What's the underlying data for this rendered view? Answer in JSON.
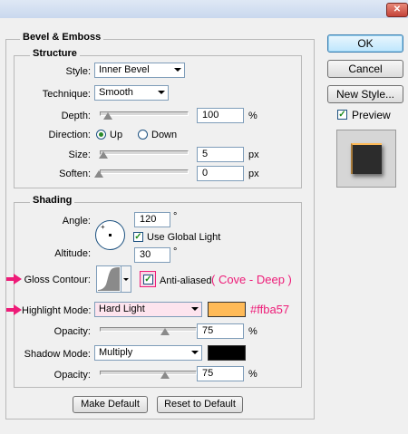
{
  "window": {
    "close_glyph": "✕"
  },
  "bevel_emboss": {
    "title": "Bevel & Emboss"
  },
  "structure": {
    "title": "Structure",
    "style": {
      "label": "Style:",
      "value": "Inner Bevel"
    },
    "technique": {
      "label": "Technique:",
      "value": "Smooth"
    },
    "depth": {
      "label": "Depth:",
      "value": "100",
      "unit": "%",
      "slider_pct": 0.1
    },
    "direction": {
      "label": "Direction:",
      "up": "Up",
      "down": "Down",
      "selected": "Up"
    },
    "size": {
      "label": "Size:",
      "value": "5",
      "unit": "px",
      "slider_pct": 0.04
    },
    "soften": {
      "label": "Soften:",
      "value": "0",
      "unit": "px",
      "slider_pct": 0
    }
  },
  "shading": {
    "title": "Shading",
    "angle": {
      "label": "Angle:",
      "value": "120",
      "unit": "°"
    },
    "use_global_light": {
      "label": "Use Global Light",
      "checked": true
    },
    "altitude": {
      "label": "Altitude:",
      "value": "30",
      "unit": "°"
    },
    "gloss_contour": {
      "label": "Gloss Contour:",
      "anti_aliased_label": "Anti-aliased",
      "anti_aliased_checked": true
    },
    "highlight_mode": {
      "label": "Highlight Mode:",
      "value": "Hard Light",
      "color": "#ffba57"
    },
    "highlight_opacity": {
      "label": "Opacity:",
      "value": "75",
      "unit": "%",
      "slider_pct": 0.75
    },
    "shadow_mode": {
      "label": "Shadow Mode:",
      "value": "Multiply",
      "color": "#000000"
    },
    "shadow_opacity": {
      "label": "Opacity:",
      "value": "75",
      "unit": "%",
      "slider_pct": 0.75
    }
  },
  "buttons": {
    "make_default": "Make Default",
    "reset_default": "Reset to Default",
    "ok": "OK",
    "cancel": "Cancel",
    "new_style": "New Style...",
    "preview": "Preview"
  },
  "annotations": {
    "contour_note": "( Cove - Deep )",
    "color_note": "#ffba57"
  }
}
